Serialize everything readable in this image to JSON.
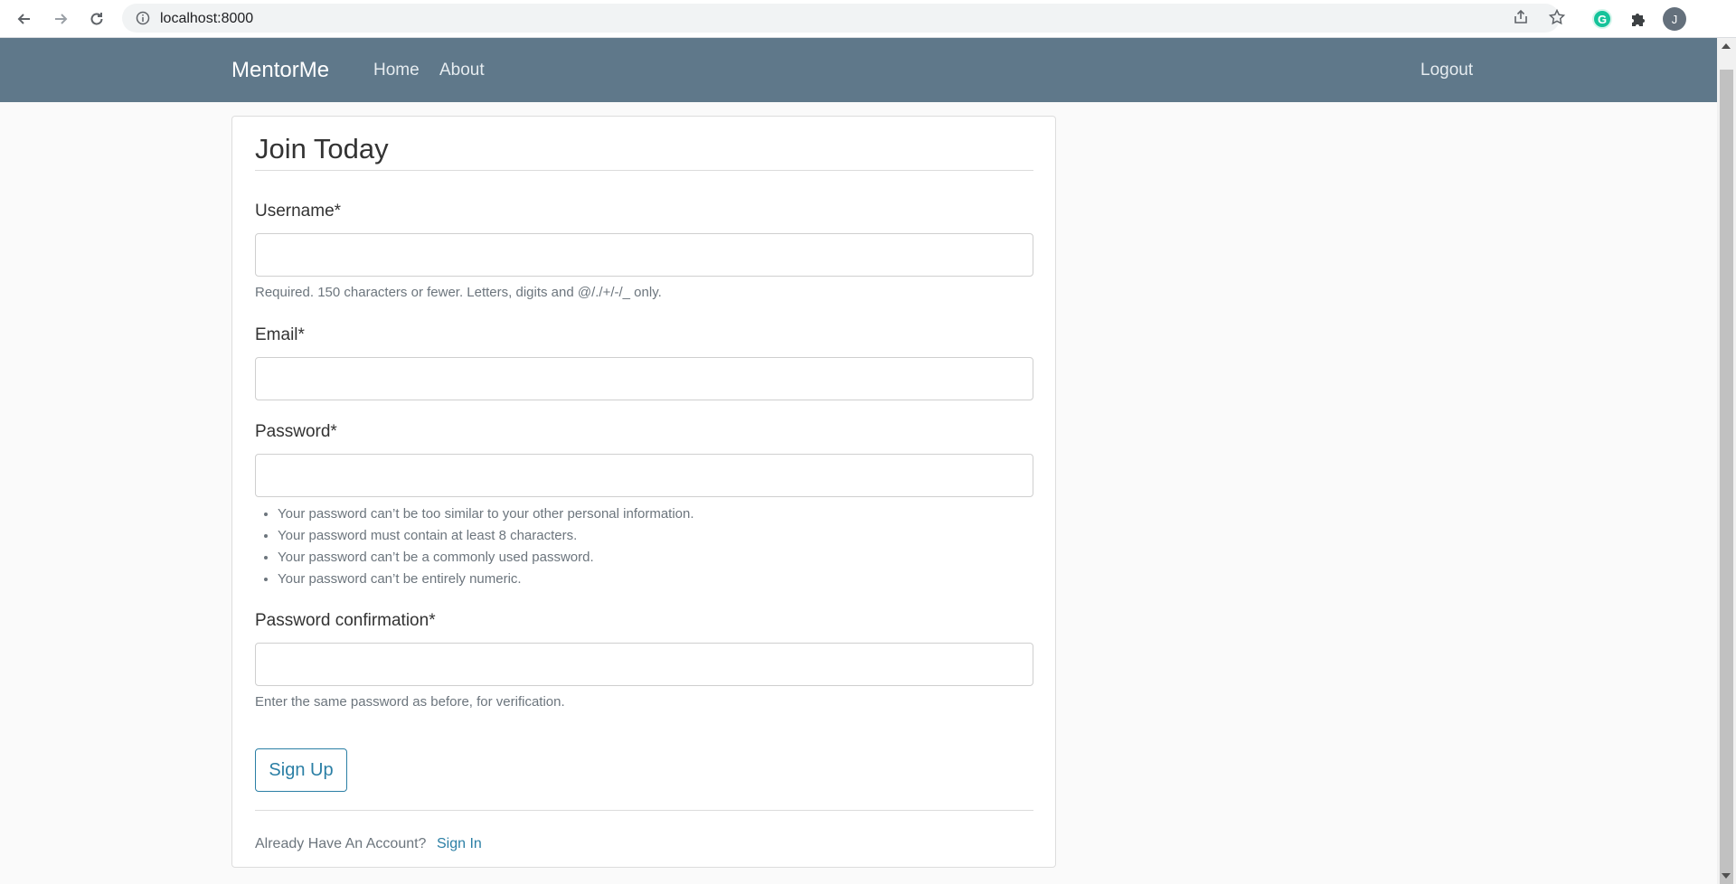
{
  "browser": {
    "url": "localhost:8000",
    "profile_initial": "J",
    "extension_initial": "G"
  },
  "navbar": {
    "brand": "MentorMe",
    "links": [
      {
        "label": "Home"
      },
      {
        "label": "About"
      }
    ],
    "logout_label": "Logout",
    "background_color": "#5f788a"
  },
  "form": {
    "title": "Join Today",
    "username": {
      "label": "Username*",
      "value": "",
      "help": "Required. 150 characters or fewer. Letters, digits and @/./+/-/_ only."
    },
    "email": {
      "label": "Email*",
      "value": ""
    },
    "password": {
      "label": "Password*",
      "value": "",
      "rules": [
        "Your password can’t be too similar to your other personal information.",
        "Your password must contain at least 8 characters.",
        "Your password can’t be a commonly used password.",
        "Your password can’t be entirely numeric."
      ]
    },
    "password_confirmation": {
      "label": "Password confirmation*",
      "value": "",
      "help": "Enter the same password as before, for verification."
    },
    "submit_label": "Sign Up",
    "footer": {
      "text": "Already Have An Account?",
      "link_label": "Sign In"
    }
  },
  "icons": {
    "back": "back-arrow-icon",
    "forward": "forward-arrow-icon",
    "reload": "reload-icon",
    "info": "info-icon",
    "share": "share-icon",
    "bookmark": "star-icon",
    "extensions": "puzzle-icon"
  }
}
